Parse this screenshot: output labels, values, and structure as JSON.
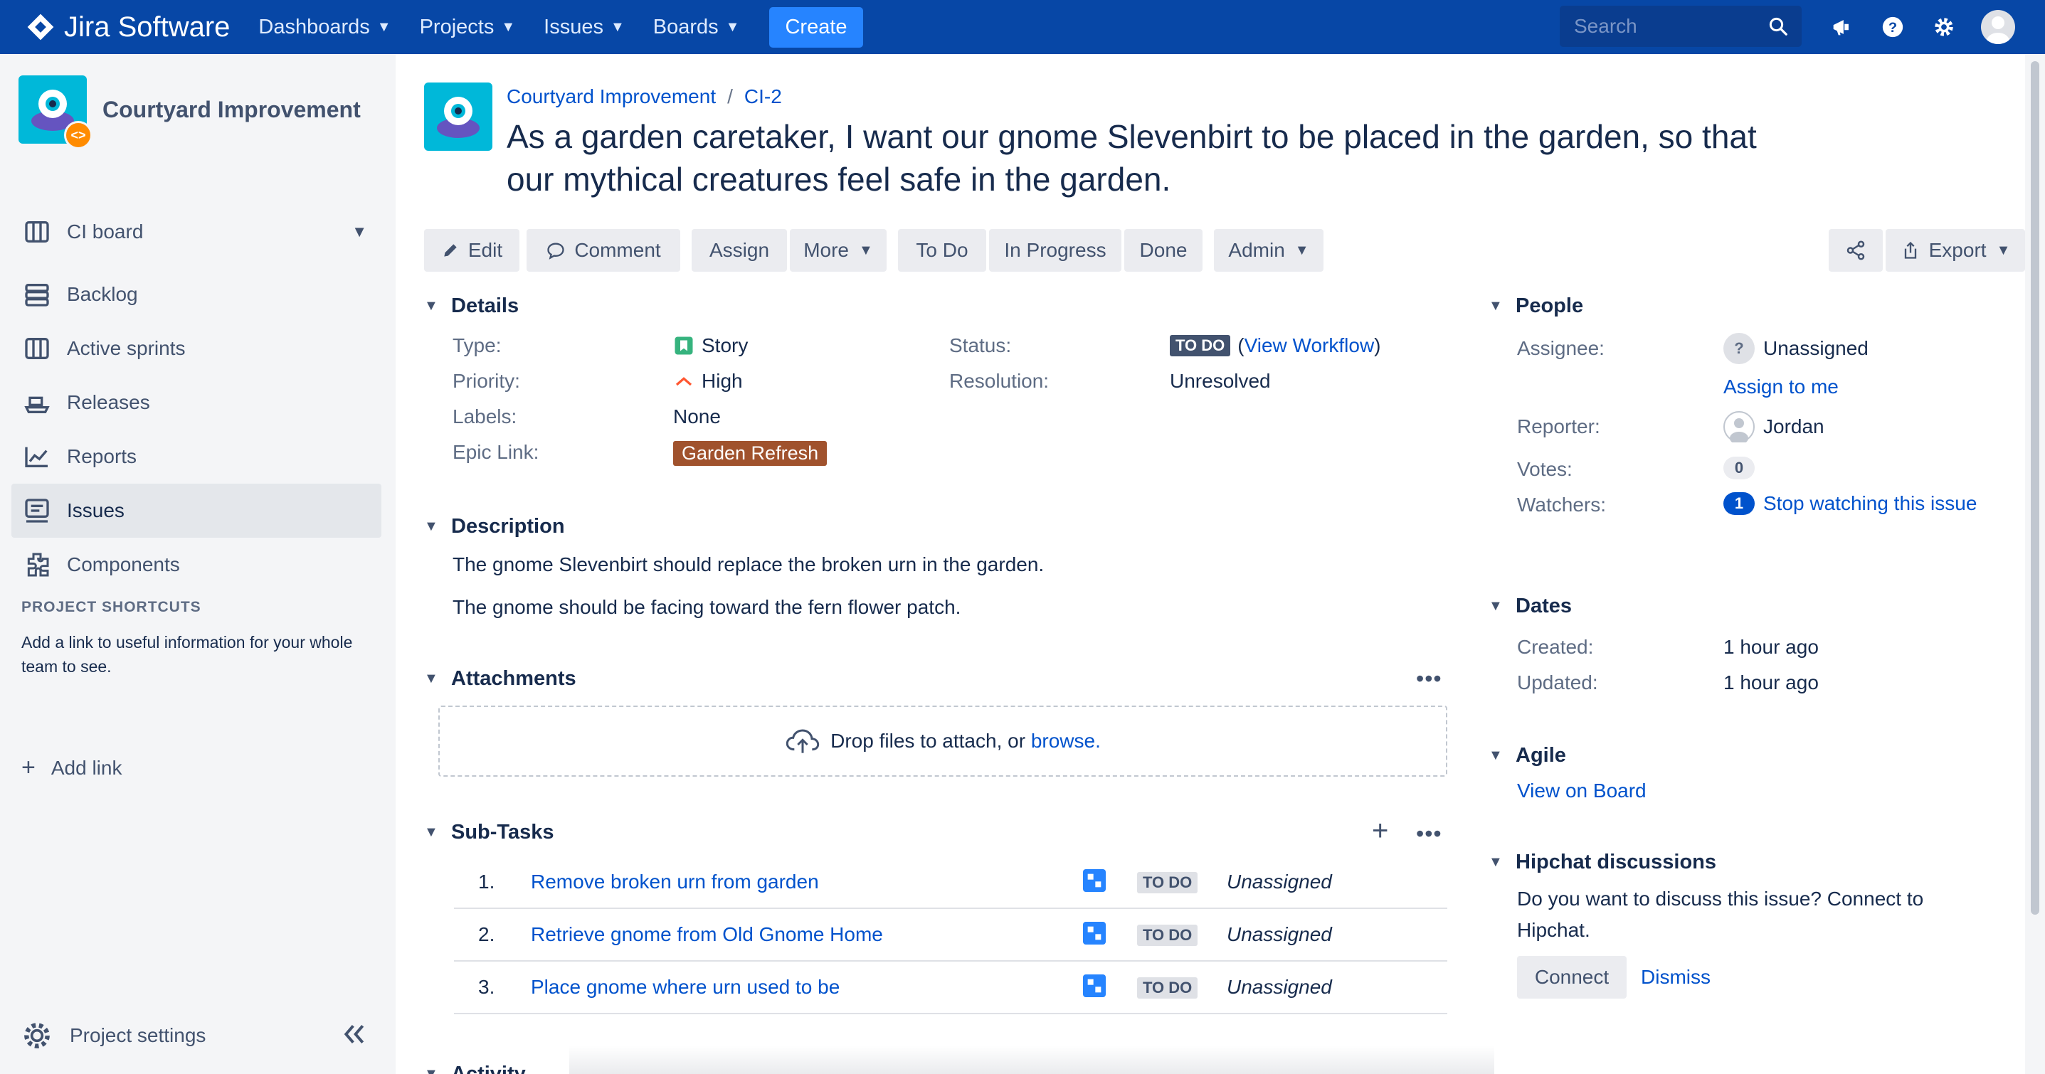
{
  "topnav": {
    "product": "Jira Software",
    "menus": [
      "Dashboards",
      "Projects",
      "Issues",
      "Boards"
    ],
    "create_label": "Create",
    "search_placeholder": "Search",
    "accent": "#0747A6"
  },
  "sidebar": {
    "project_name": "Courtyard Improvement",
    "items": [
      {
        "label": "CI board",
        "icon": "board-icon"
      },
      {
        "label": "Backlog",
        "icon": "backlog-icon"
      },
      {
        "label": "Active sprints",
        "icon": "sprints-icon"
      },
      {
        "label": "Releases",
        "icon": "releases-icon"
      },
      {
        "label": "Reports",
        "icon": "reports-icon"
      },
      {
        "label": "Issues",
        "icon": "issues-icon"
      },
      {
        "label": "Components",
        "icon": "components-icon"
      }
    ],
    "shortcuts_title": "PROJECT SHORTCUTS",
    "shortcuts_text": "Add a link to useful information for your whole team to see.",
    "add_link": "Add link",
    "project_settings": "Project settings"
  },
  "issue": {
    "breadcrumb_project": "Courtyard Improvement",
    "breadcrumb_sep": "/",
    "key": "CI-2",
    "summary": "As a garden caretaker, I want our gnome Slevenbirt to be placed in the garden, so that our mythical creatures feel safe in the garden."
  },
  "toolbar": {
    "edit": "Edit",
    "comment": "Comment",
    "assign": "Assign",
    "more": "More",
    "todo": "To Do",
    "in_progress": "In Progress",
    "done": "Done",
    "admin": "Admin",
    "export": "Export"
  },
  "details": {
    "title": "Details",
    "type_label": "Type:",
    "type_value": "Story",
    "priority_label": "Priority:",
    "priority_value": "High",
    "labels_label": "Labels:",
    "labels_value": "None",
    "epic_label": "Epic Link:",
    "epic_value": "Garden Refresh",
    "status_label": "Status:",
    "status_value": "TO DO",
    "view_workflow": "View Workflow",
    "resolution_label": "Resolution:",
    "resolution_value": "Unresolved"
  },
  "description": {
    "title": "Description",
    "line1": "The gnome Slevenbirt should replace the broken urn in the garden.",
    "line2": "The gnome should be facing toward the fern flower patch."
  },
  "attachments": {
    "title": "Attachments",
    "drop_text": "Drop files to attach, or",
    "browse": "browse."
  },
  "subtasks": {
    "title": "Sub-Tasks",
    "rows": [
      {
        "num": "1.",
        "title": "Remove broken urn from garden",
        "status": "TO DO",
        "assignee": "Unassigned"
      },
      {
        "num": "2.",
        "title": "Retrieve gnome from Old Gnome Home",
        "status": "TO DO",
        "assignee": "Unassigned"
      },
      {
        "num": "3.",
        "title": "Place gnome where urn used to be",
        "status": "TO DO",
        "assignee": "Unassigned"
      }
    ]
  },
  "activity": {
    "title": "Activity"
  },
  "people": {
    "title": "People",
    "assignee_label": "Assignee:",
    "assignee_value": "Unassigned",
    "assign_to_me": "Assign to me",
    "reporter_label": "Reporter:",
    "reporter_value": "Jordan",
    "votes_label": "Votes:",
    "votes_value": "0",
    "watchers_label": "Watchers:",
    "watchers_count": "1",
    "stop_watching": "Stop watching this issue"
  },
  "dates": {
    "title": "Dates",
    "created_label": "Created:",
    "created_value": "1 hour ago",
    "updated_label": "Updated:",
    "updated_value": "1 hour ago"
  },
  "agile": {
    "title": "Agile",
    "view_on_board": "View on Board"
  },
  "hipchat": {
    "title": "Hipchat discussions",
    "text": "Do you want to discuss this issue? Connect to Hipchat.",
    "connect": "Connect",
    "dismiss": "Dismiss"
  }
}
